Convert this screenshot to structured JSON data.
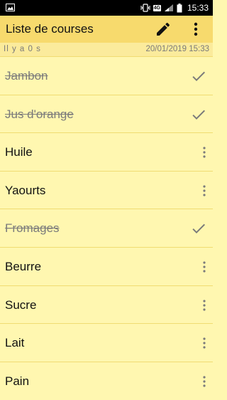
{
  "status_bar": {
    "time": "15:33",
    "network": "4G"
  },
  "app_bar": {
    "title": "Liste de courses"
  },
  "meta": {
    "relative_time": "Il y a 0 s",
    "timestamp": "20/01/2019 15:33"
  },
  "items": [
    {
      "label": "Jambon",
      "checked": true
    },
    {
      "label": "Jus d'orange",
      "checked": true
    },
    {
      "label": "Huile",
      "checked": false
    },
    {
      "label": "Yaourts",
      "checked": false
    },
    {
      "label": "Fromages",
      "checked": true
    },
    {
      "label": "Beurre",
      "checked": false
    },
    {
      "label": "Sucre",
      "checked": false
    },
    {
      "label": "Lait",
      "checked": false
    },
    {
      "label": "Pain",
      "checked": false
    }
  ]
}
